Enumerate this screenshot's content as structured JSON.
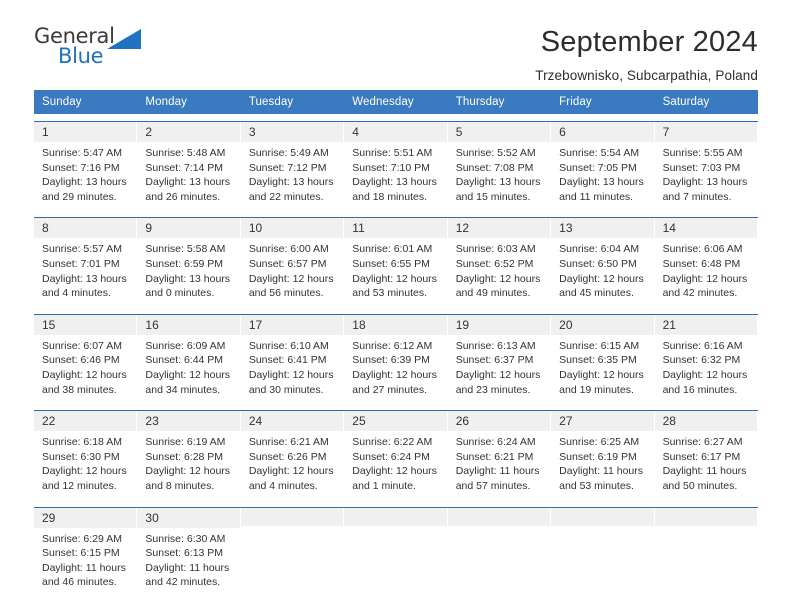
{
  "brand": {
    "name_part1": "General",
    "name_part2": "Blue",
    "triangle_color": "#1f72bd"
  },
  "header": {
    "title": "September 2024",
    "subtitle": "Trzebownisko, Subcarpathia, Poland"
  },
  "colors": {
    "header_row": "#3a7ac0",
    "row_border": "#2f6cb0",
    "day_band": "#f0f0f0",
    "text": "#333333"
  },
  "weekdays": [
    "Sunday",
    "Monday",
    "Tuesday",
    "Wednesday",
    "Thursday",
    "Friday",
    "Saturday"
  ],
  "weeks": [
    [
      {
        "day": "1",
        "sunrise": "Sunrise: 5:47 AM",
        "sunset": "Sunset: 7:16 PM",
        "daylight1": "Daylight: 13 hours",
        "daylight2": "and 29 minutes."
      },
      {
        "day": "2",
        "sunrise": "Sunrise: 5:48 AM",
        "sunset": "Sunset: 7:14 PM",
        "daylight1": "Daylight: 13 hours",
        "daylight2": "and 26 minutes."
      },
      {
        "day": "3",
        "sunrise": "Sunrise: 5:49 AM",
        "sunset": "Sunset: 7:12 PM",
        "daylight1": "Daylight: 13 hours",
        "daylight2": "and 22 minutes."
      },
      {
        "day": "4",
        "sunrise": "Sunrise: 5:51 AM",
        "sunset": "Sunset: 7:10 PM",
        "daylight1": "Daylight: 13 hours",
        "daylight2": "and 18 minutes."
      },
      {
        "day": "5",
        "sunrise": "Sunrise: 5:52 AM",
        "sunset": "Sunset: 7:08 PM",
        "daylight1": "Daylight: 13 hours",
        "daylight2": "and 15 minutes."
      },
      {
        "day": "6",
        "sunrise": "Sunrise: 5:54 AM",
        "sunset": "Sunset: 7:05 PM",
        "daylight1": "Daylight: 13 hours",
        "daylight2": "and 11 minutes."
      },
      {
        "day": "7",
        "sunrise": "Sunrise: 5:55 AM",
        "sunset": "Sunset: 7:03 PM",
        "daylight1": "Daylight: 13 hours",
        "daylight2": "and 7 minutes."
      }
    ],
    [
      {
        "day": "8",
        "sunrise": "Sunrise: 5:57 AM",
        "sunset": "Sunset: 7:01 PM",
        "daylight1": "Daylight: 13 hours",
        "daylight2": "and 4 minutes."
      },
      {
        "day": "9",
        "sunrise": "Sunrise: 5:58 AM",
        "sunset": "Sunset: 6:59 PM",
        "daylight1": "Daylight: 13 hours",
        "daylight2": "and 0 minutes."
      },
      {
        "day": "10",
        "sunrise": "Sunrise: 6:00 AM",
        "sunset": "Sunset: 6:57 PM",
        "daylight1": "Daylight: 12 hours",
        "daylight2": "and 56 minutes."
      },
      {
        "day": "11",
        "sunrise": "Sunrise: 6:01 AM",
        "sunset": "Sunset: 6:55 PM",
        "daylight1": "Daylight: 12 hours",
        "daylight2": "and 53 minutes."
      },
      {
        "day": "12",
        "sunrise": "Sunrise: 6:03 AM",
        "sunset": "Sunset: 6:52 PM",
        "daylight1": "Daylight: 12 hours",
        "daylight2": "and 49 minutes."
      },
      {
        "day": "13",
        "sunrise": "Sunrise: 6:04 AM",
        "sunset": "Sunset: 6:50 PM",
        "daylight1": "Daylight: 12 hours",
        "daylight2": "and 45 minutes."
      },
      {
        "day": "14",
        "sunrise": "Sunrise: 6:06 AM",
        "sunset": "Sunset: 6:48 PM",
        "daylight1": "Daylight: 12 hours",
        "daylight2": "and 42 minutes."
      }
    ],
    [
      {
        "day": "15",
        "sunrise": "Sunrise: 6:07 AM",
        "sunset": "Sunset: 6:46 PM",
        "daylight1": "Daylight: 12 hours",
        "daylight2": "and 38 minutes."
      },
      {
        "day": "16",
        "sunrise": "Sunrise: 6:09 AM",
        "sunset": "Sunset: 6:44 PM",
        "daylight1": "Daylight: 12 hours",
        "daylight2": "and 34 minutes."
      },
      {
        "day": "17",
        "sunrise": "Sunrise: 6:10 AM",
        "sunset": "Sunset: 6:41 PM",
        "daylight1": "Daylight: 12 hours",
        "daylight2": "and 30 minutes."
      },
      {
        "day": "18",
        "sunrise": "Sunrise: 6:12 AM",
        "sunset": "Sunset: 6:39 PM",
        "daylight1": "Daylight: 12 hours",
        "daylight2": "and 27 minutes."
      },
      {
        "day": "19",
        "sunrise": "Sunrise: 6:13 AM",
        "sunset": "Sunset: 6:37 PM",
        "daylight1": "Daylight: 12 hours",
        "daylight2": "and 23 minutes."
      },
      {
        "day": "20",
        "sunrise": "Sunrise: 6:15 AM",
        "sunset": "Sunset: 6:35 PM",
        "daylight1": "Daylight: 12 hours",
        "daylight2": "and 19 minutes."
      },
      {
        "day": "21",
        "sunrise": "Sunrise: 6:16 AM",
        "sunset": "Sunset: 6:32 PM",
        "daylight1": "Daylight: 12 hours",
        "daylight2": "and 16 minutes."
      }
    ],
    [
      {
        "day": "22",
        "sunrise": "Sunrise: 6:18 AM",
        "sunset": "Sunset: 6:30 PM",
        "daylight1": "Daylight: 12 hours",
        "daylight2": "and 12 minutes."
      },
      {
        "day": "23",
        "sunrise": "Sunrise: 6:19 AM",
        "sunset": "Sunset: 6:28 PM",
        "daylight1": "Daylight: 12 hours",
        "daylight2": "and 8 minutes."
      },
      {
        "day": "24",
        "sunrise": "Sunrise: 6:21 AM",
        "sunset": "Sunset: 6:26 PM",
        "daylight1": "Daylight: 12 hours",
        "daylight2": "and 4 minutes."
      },
      {
        "day": "25",
        "sunrise": "Sunrise: 6:22 AM",
        "sunset": "Sunset: 6:24 PM",
        "daylight1": "Daylight: 12 hours",
        "daylight2": "and 1 minute."
      },
      {
        "day": "26",
        "sunrise": "Sunrise: 6:24 AM",
        "sunset": "Sunset: 6:21 PM",
        "daylight1": "Daylight: 11 hours",
        "daylight2": "and 57 minutes."
      },
      {
        "day": "27",
        "sunrise": "Sunrise: 6:25 AM",
        "sunset": "Sunset: 6:19 PM",
        "daylight1": "Daylight: 11 hours",
        "daylight2": "and 53 minutes."
      },
      {
        "day": "28",
        "sunrise": "Sunrise: 6:27 AM",
        "sunset": "Sunset: 6:17 PM",
        "daylight1": "Daylight: 11 hours",
        "daylight2": "and 50 minutes."
      }
    ],
    [
      {
        "day": "29",
        "sunrise": "Sunrise: 6:29 AM",
        "sunset": "Sunset: 6:15 PM",
        "daylight1": "Daylight: 11 hours",
        "daylight2": "and 46 minutes."
      },
      {
        "day": "30",
        "sunrise": "Sunrise: 6:30 AM",
        "sunset": "Sunset: 6:13 PM",
        "daylight1": "Daylight: 11 hours",
        "daylight2": "and 42 minutes."
      },
      {
        "day": "",
        "sunrise": "",
        "sunset": "",
        "daylight1": "",
        "daylight2": ""
      },
      {
        "day": "",
        "sunrise": "",
        "sunset": "",
        "daylight1": "",
        "daylight2": ""
      },
      {
        "day": "",
        "sunrise": "",
        "sunset": "",
        "daylight1": "",
        "daylight2": ""
      },
      {
        "day": "",
        "sunrise": "",
        "sunset": "",
        "daylight1": "",
        "daylight2": ""
      },
      {
        "day": "",
        "sunrise": "",
        "sunset": "",
        "daylight1": "",
        "daylight2": ""
      }
    ]
  ]
}
